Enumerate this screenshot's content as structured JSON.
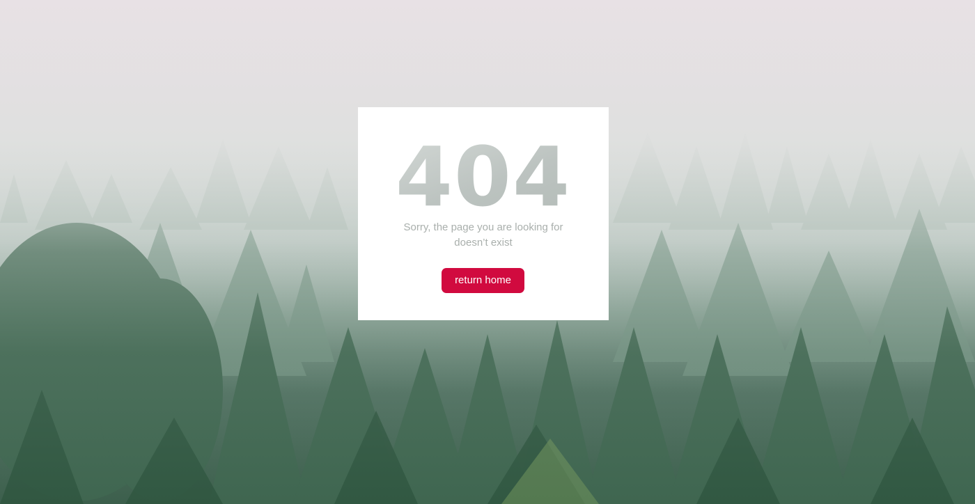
{
  "error": {
    "code": "404",
    "message": "Sorry, the page you are looking for doesn’t exist",
    "button_label": "return home"
  },
  "colors": {
    "button_bg": "#d10a3f",
    "button_text": "#ffffff",
    "code_text": "#c6ccc9",
    "message_text": "#a9afac",
    "card_bg": "#ffffff"
  }
}
